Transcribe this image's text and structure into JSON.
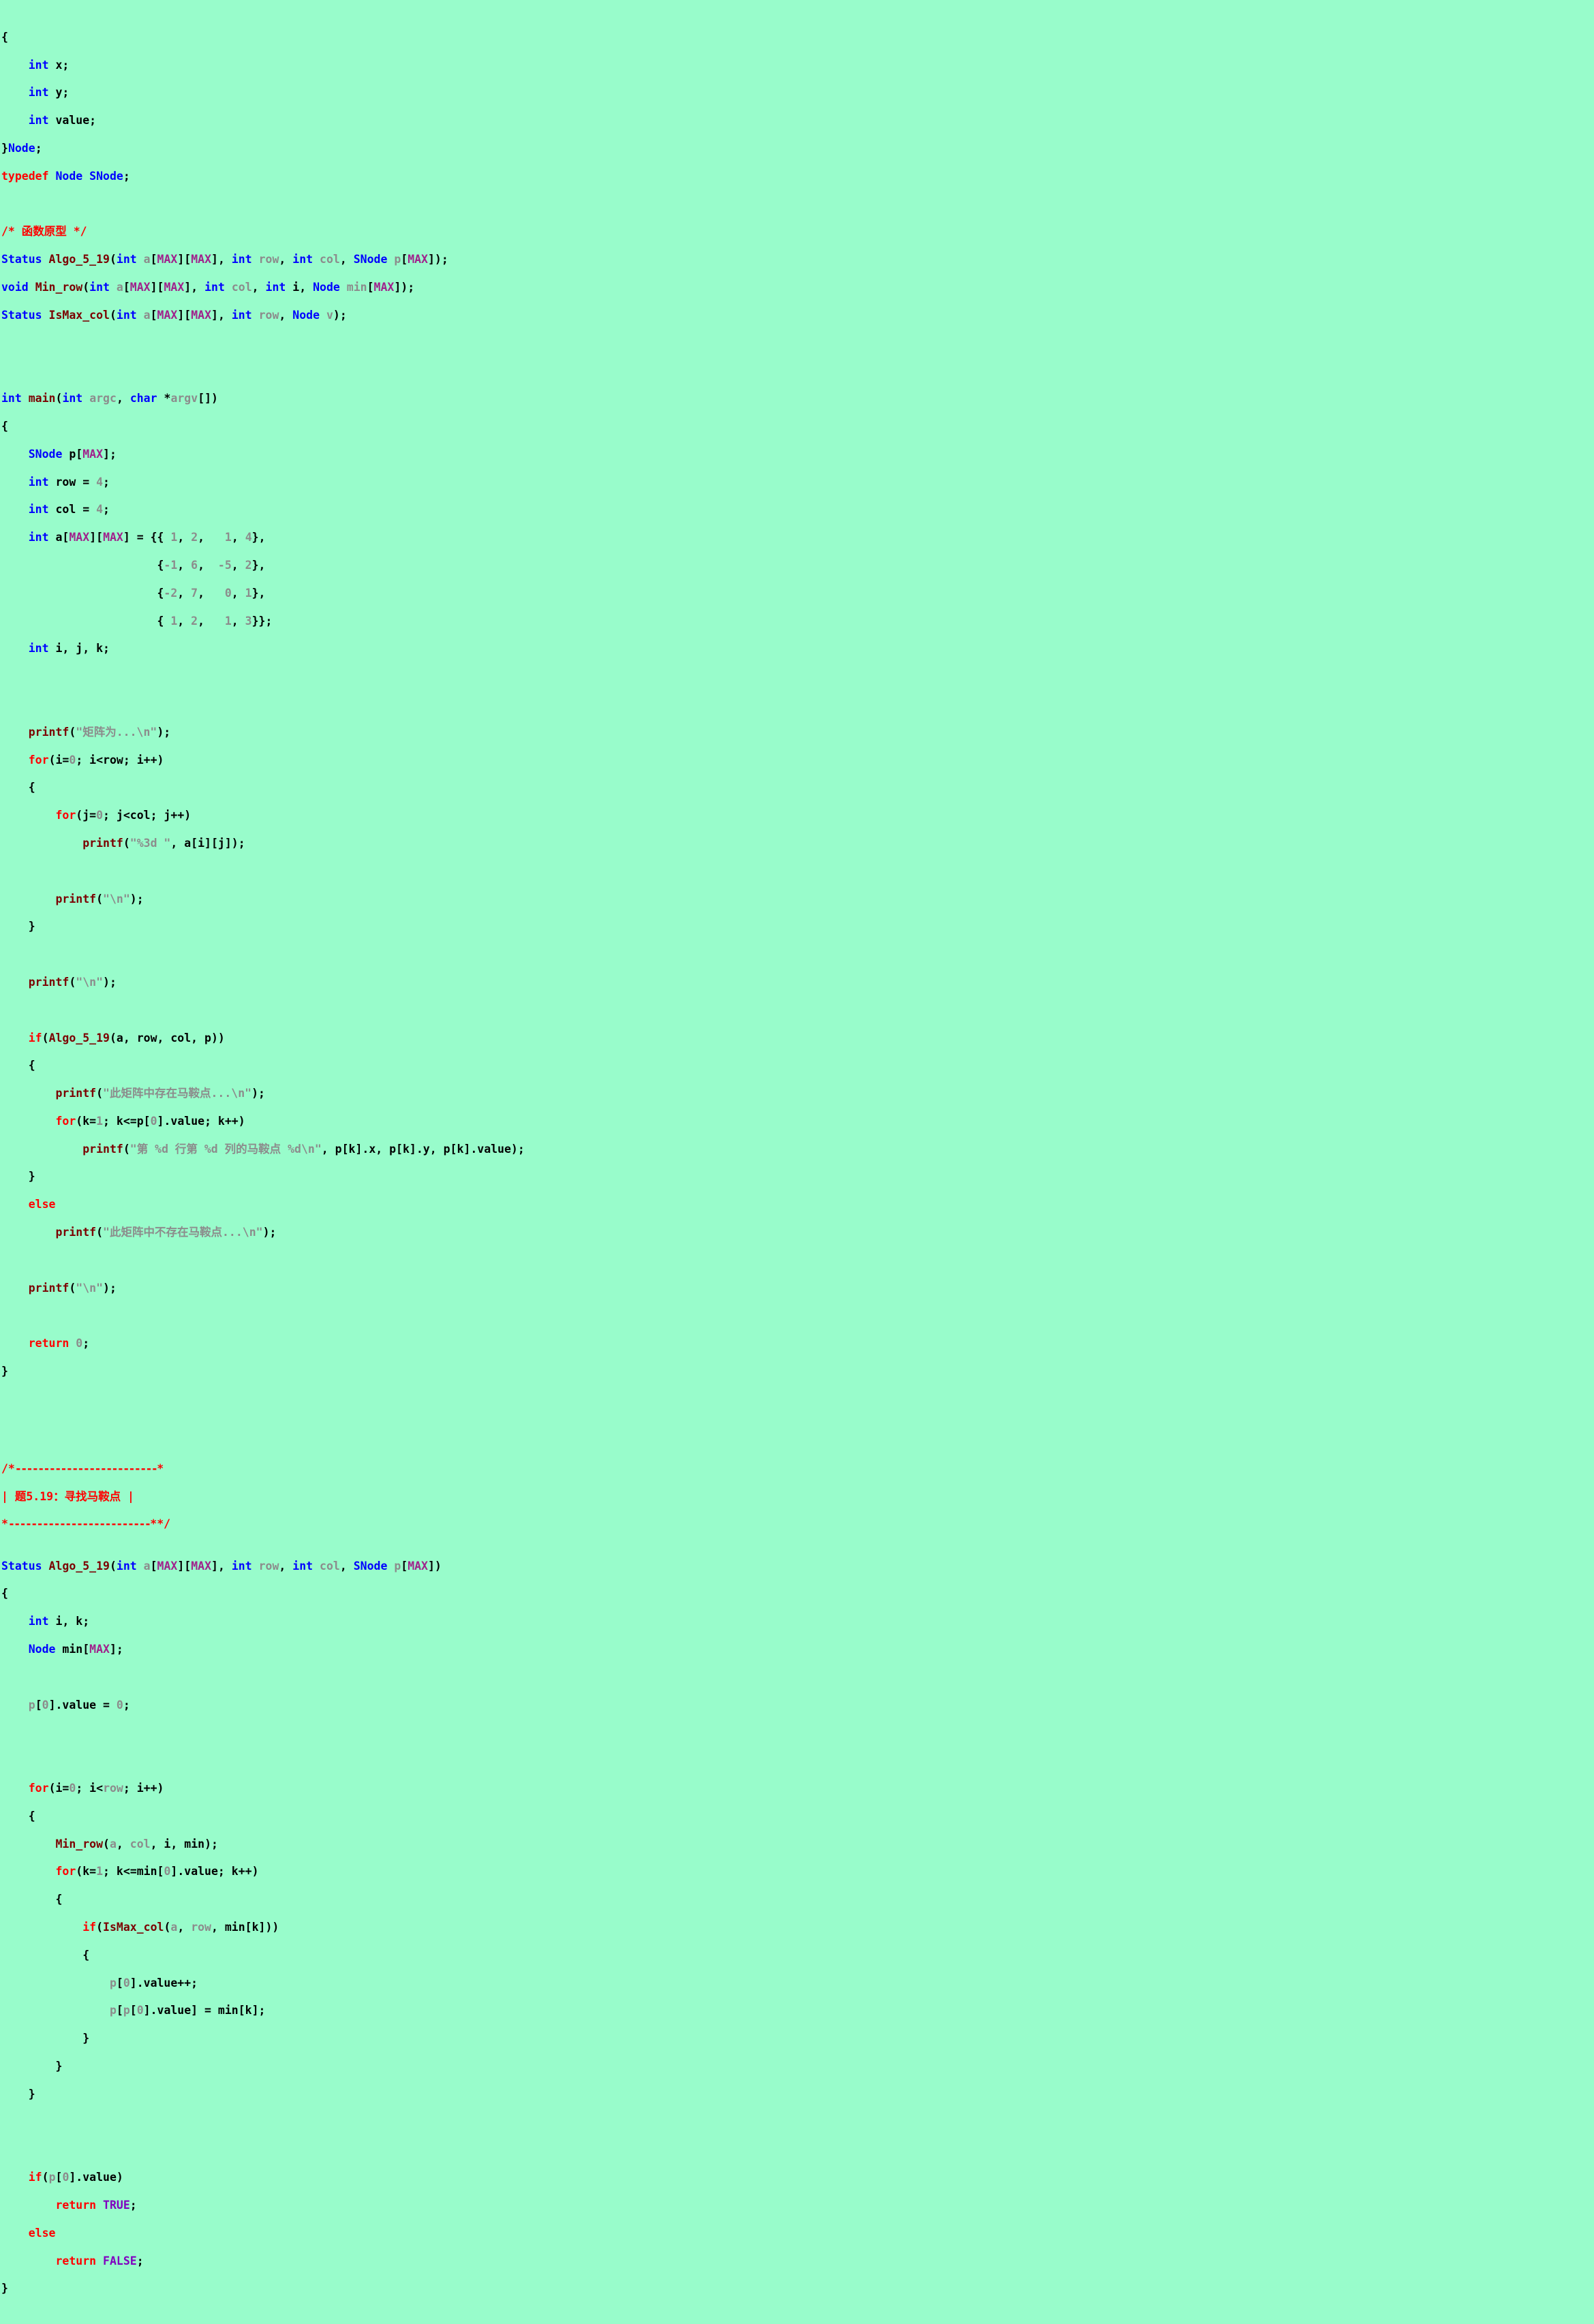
{
  "document": {
    "kind": "source-code-listing",
    "language": "C",
    "title": "题5.19：寻找马鞍点",
    "background_color": "#98fccb"
  },
  "palette": {
    "background": "#98fccb",
    "keyword": "#0000ff",
    "type": "#0000ff",
    "function": "#7b0000",
    "control": "#ff0000",
    "punctuation": "#000000",
    "literal": "#8c8c8c",
    "string": "#8c8c8c",
    "macro": "#a0228c",
    "comment": "#ff0000",
    "constant": "#8000c0"
  },
  "comments": {
    "prototypes": "/* 函数原型 */",
    "banner_title": "题5.19：寻找马鞍点",
    "banner_open": "/*",
    "banner_close": "*/"
  },
  "strings": {
    "matrix_is": "\"矩阵为...\\n\"",
    "fmt_3d": "\"%3d \"",
    "newline": "\"\\n\"",
    "saddle_exists": "\"此矩阵中存在马鞍点...\\n\"",
    "saddle_detail": "\"第 %d 行第 %d 列的马鞍点 %d\\n\"",
    "saddle_not_exists": "\"此矩阵中不存在马鞍点...\\n\""
  },
  "identifiers": {
    "struct_fields": [
      "x",
      "y",
      "value"
    ],
    "struct_name": "Node",
    "typedef_alias": "SNode",
    "macro": "MAX",
    "functions": [
      "Algo_5_19",
      "Min_row",
      "IsMax_col",
      "main",
      "printf"
    ],
    "locals": [
      "p",
      "row",
      "col",
      "a",
      "i",
      "j",
      "k",
      "min",
      "argc",
      "argv"
    ],
    "constants": [
      "TRUE",
      "FALSE"
    ]
  },
  "values": {
    "row": "4",
    "col": "4",
    "zero": "0",
    "one": "1",
    "matrix": [
      [
        "1",
        "2",
        "1",
        "4"
      ],
      [
        "-1",
        "6",
        "-5",
        "2"
      ],
      [
        "-2",
        "7",
        "0",
        "1"
      ],
      [
        "1",
        "2",
        "1",
        "3"
      ]
    ]
  },
  "lines": [
    "{",
    "    int x;",
    "    int y;",
    "    int value;",
    "}Node;",
    "typedef Node SNode;",
    "",
    "/* 函数原型 */",
    "Status Algo_5_19(int a[MAX][MAX], int row, int col, SNode p[MAX]);",
    "void Min_row(int a[MAX][MAX], int col, int i, Node min[MAX]);",
    "Status IsMax_col(int a[MAX][MAX], int row, Node v);",
    "",
    "int main(int argc, char *argv[])",
    "{",
    "    SNode p[MAX];",
    "    int row = 4;",
    "    int col = 4;",
    "    int a[MAX][MAX] = {{ 1, 2,   1, 4},",
    "                       {-1, 6,  -5, 2},",
    "                       {-2, 7,   0, 1},",
    "                       { 1, 2,   1, 3}};",
    "    int i, j, k;",
    "",
    "    printf(\"矩阵为...\\n\");",
    "    for(i=0; i<row; i++)",
    "    {",
    "        for(j=0; j<col; j++)",
    "            printf(\"%3d \", a[i][j]);",
    "",
    "        printf(\"\\n\");",
    "    }",
    "",
    "    printf(\"\\n\");",
    "",
    "    if(Algo_5_19(a, row, col, p))",
    "    {",
    "        printf(\"此矩阵中存在马鞍点...\\n\");",
    "        for(k=1; k<=p[0].value; k++)",
    "            printf(\"第 %d 行第 %d 列的马鞍点 %d\\n\", p[k].x, p[k].y, p[k].value);",
    "    }",
    "    else",
    "        printf(\"此矩阵中不存在马鞍点...\\n\");",
    "",
    "    printf(\"\\n\");",
    "",
    "    return 0;",
    "}",
    "",
    "/*-------------------------*",
    "| 题5.19：寻找马鞍点 |",
    "*-------------------------*/",
    "Status Algo_5_19(int a[MAX][MAX], int row, int col, SNode p[MAX])",
    "{",
    "    int i, k;",
    "    Node min[MAX];",
    "",
    "    p[0].value = 0;",
    "",
    "    for(i=0; i<row; i++)",
    "    {",
    "        Min_row(a, col, i, min);",
    "        for(k=1; k<=min[0].value; k++)",
    "        {",
    "            if(IsMax_col(a, row, min[k]))",
    "            {",
    "                p[0].value++;",
    "                p[p[0].value] = min[k];",
    "            }",
    "        }",
    "    }",
    "",
    "    if(p[0].value)",
    "        return TRUE;",
    "    else",
    "        return FALSE;",
    "}"
  ]
}
